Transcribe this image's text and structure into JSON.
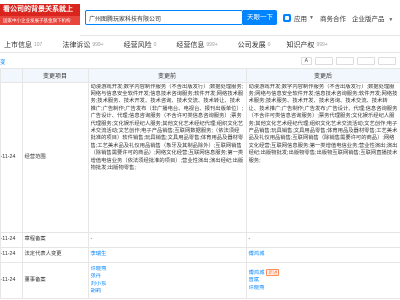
{
  "logo": {
    "title": "看公司的背景关系就上",
    "subtitle": "国家中小企业发展子基金旗下机构"
  },
  "search": {
    "value": "广州图腾玩家科技有限公司",
    "button": "天眼一下"
  },
  "header": {
    "app_label": "应用",
    "nav": [
      "商务合作",
      "企业版产品"
    ]
  },
  "tabs": [
    {
      "label": "上市信息",
      "count": "107"
    },
    {
      "label": "法律诉讼",
      "count": "999+"
    },
    {
      "label": "经营风险",
      "count": "0"
    },
    {
      "label": "经营信息",
      "count": "999+"
    },
    {
      "label": "公司发展",
      "count": "0"
    },
    {
      "label": "知识产权",
      "count": "999+"
    }
  ],
  "sub": {
    "left": "变",
    "buttons": [
      "A",
      "",
      "",
      "",
      ""
    ]
  },
  "table": {
    "headers": [
      "序号",
      "变更日期",
      "变更项目",
      "变更前",
      "变更后"
    ],
    "rows": [
      {
        "date": "-11-24",
        "item": "经营范围",
        "before": "动漫游戏开发;数字内容制作服务（不含出版发行）;数据处理服务;网络与信息安全软件开发;信息技术咨询服务;软件开发;网络技术服务;技术服务、技术开发、技术咨询、技术交流、技术转让、技术推广;广告制作;广告发布（非广播电台、电视台、报刊出版单位）;广告设计、代理;信息咨询服务（不含许可类信息咨询服务）;票务代理服务;文化娱乐经纪人服务;其他文化艺术经纪代理;组织文化艺术交流活动;文艺创作;电子产品销售;互联网数据服务;（依法须经批准的项目）软件销售;玩具销售;文具用品零售;体育用品及器材零售;工艺美术品及礼仪用品销售（象牙及其制品除外）;互联网销售（除销售需要许可的商品）;网络文化经营;互联网信息服务;第一类增值电信业务（依法须经批准的项目）;营业性演出;演出经纪;出版物批发;出版物零售;",
        "after": "动漫游戏开发;数字内容制作服务（不含出版发行）;数据处理服务;网络与信息安全软件开发;信息技术咨询服务;软件开发;网络技术服务;技术服务、技术开发、技术咨询、技术交流、技术转让、技术推广;广告制作;广告发布;广告设计、代理;信息咨询服务（不含许可类信息咨询服务）;票务代理服务;文化娱乐经纪人服务;其他文化艺术经纪代理;组织文化艺术交流活动;文艺创作;电子产品销售;玩具销售;文具用品零售;体育用品及器材零售;工艺美术品及礼仪用品销售;互联网销售（除销售需要许可的商品）;网络文化经营;互联网信息服务;第一类增值电信业务;营业性演出;演出经纪;出版物批发;出版物零售;出版物互联网销售;互联网直播技术服务;"
      },
      {
        "date": "-11-24",
        "item": "章程备案",
        "before": "-",
        "after": "-"
      },
      {
        "date": "-11-24",
        "item": "法定代表人变更",
        "before": "李瑞生",
        "after": "傅鸿城"
      },
      {
        "date": "-11-24",
        "item": "董事备案",
        "before_lines": [
          "许晓燕",
          "张丹",
          "刘小东",
          "胡莉"
        ],
        "after_lines": [
          "傅鸿城",
          "曾斌",
          "许晓燕"
        ],
        "after_tag": "新进"
      }
    ]
  }
}
